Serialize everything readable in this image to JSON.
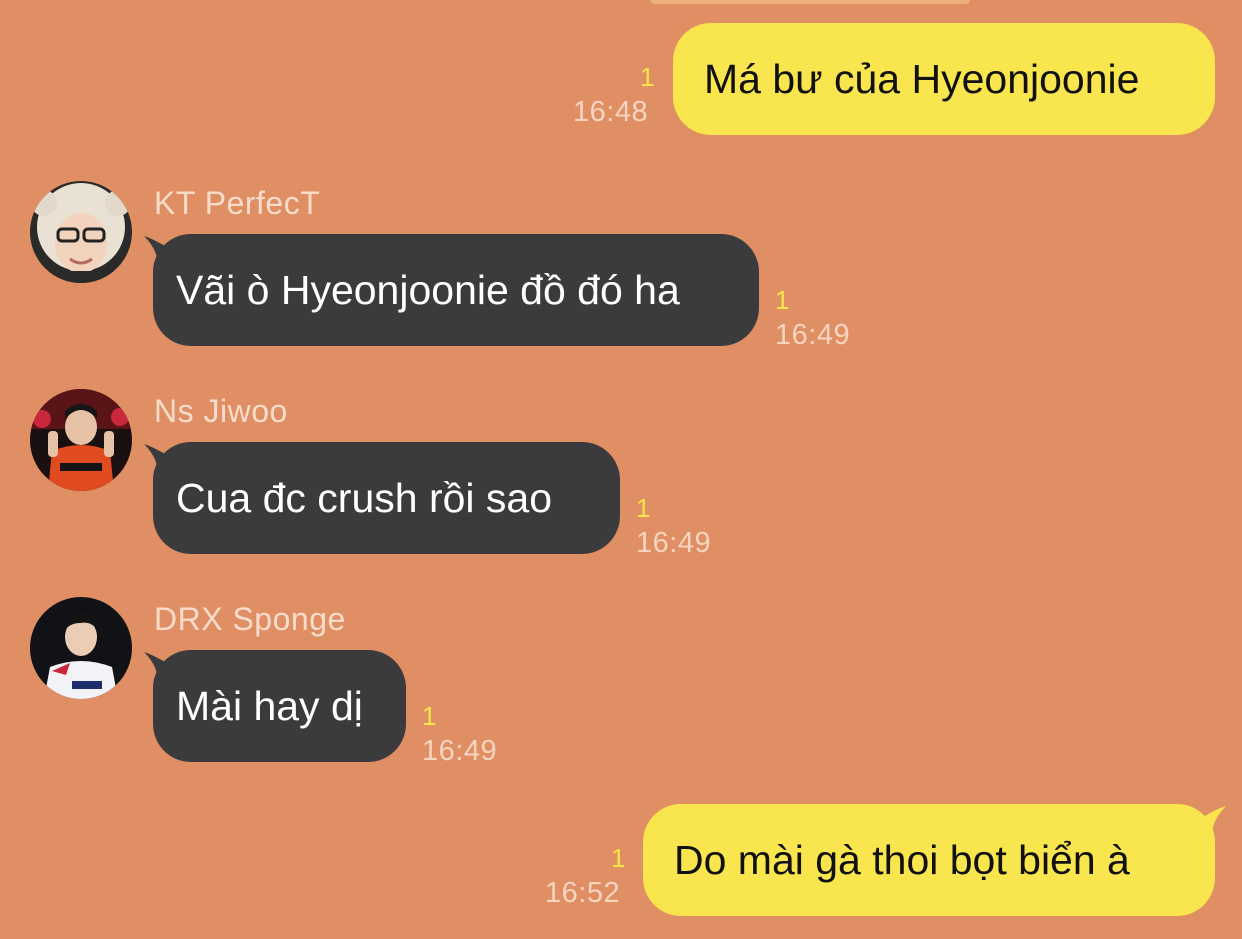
{
  "chat": {
    "messages": [
      {
        "direction": "out",
        "text": "Má bư của Hyeonjoonie",
        "unread": "1",
        "time": "16:48"
      },
      {
        "direction": "in",
        "sender": "KT PerfecT",
        "avatar_icon": "profile-avatar-icon",
        "text": "Vãi ò Hyeonjoonie đồ đó ha",
        "unread": "1",
        "time": "16:49"
      },
      {
        "direction": "in",
        "sender": "Ns Jiwoo",
        "avatar_icon": "profile-avatar-icon",
        "text": "Cua đc crush rồi sao",
        "unread": "1",
        "time": "16:49"
      },
      {
        "direction": "in",
        "sender": "DRX Sponge",
        "avatar_icon": "profile-avatar-icon",
        "text": "Mài hay dị",
        "unread": "1",
        "time": "16:49"
      },
      {
        "direction": "out",
        "text": "Do mài gà thoi bọt biển à",
        "unread": "1",
        "time": "16:52"
      }
    ]
  },
  "colors": {
    "background": "#E08E63",
    "outgoing_bubble": "#F9E54E",
    "incoming_bubble": "#3B3B3D",
    "unread_count": "#F6E44A",
    "timestamp": "#F6D5C0"
  }
}
